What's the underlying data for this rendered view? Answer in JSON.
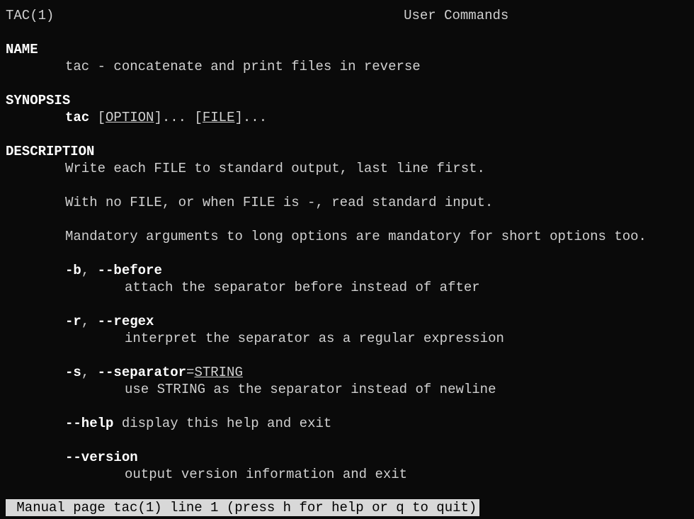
{
  "header": {
    "left": "TAC(1)",
    "center": "User Commands"
  },
  "sections": {
    "name": {
      "heading": "NAME",
      "body": "tac - concatenate and print files in reverse"
    },
    "synopsis": {
      "heading": "SYNOPSIS",
      "cmd": "tac",
      "bracket_open1": " [",
      "option": "OPTION",
      "bracket_close1": "]... [",
      "file": "FILE",
      "bracket_close2": "]..."
    },
    "description": {
      "heading": "DESCRIPTION",
      "p1": "Write each FILE to standard output, last line first.",
      "p2": "With no FILE, or when FILE is -, read standard input.",
      "p3": "Mandatory arguments to long options are mandatory for short options too.",
      "opt_b": {
        "short": "-b",
        "sep": ", ",
        "long": "--before",
        "desc": "attach the separator before instead of after"
      },
      "opt_r": {
        "short": "-r",
        "sep": ", ",
        "long": "--regex",
        "desc": "interpret the separator as a regular expression"
      },
      "opt_s": {
        "short": "-s",
        "sep": ", ",
        "long": "--separator",
        "eq": "=",
        "arg": "STRING",
        "desc": "use STRING as the separator instead of newline"
      },
      "opt_help": {
        "long": "--help",
        "space": " ",
        "desc": "display this help and exit"
      },
      "opt_version": {
        "long": "--version",
        "desc": "output version information and exit"
      }
    }
  },
  "status": " Manual page tac(1) line 1 (press h for help or q to quit)"
}
